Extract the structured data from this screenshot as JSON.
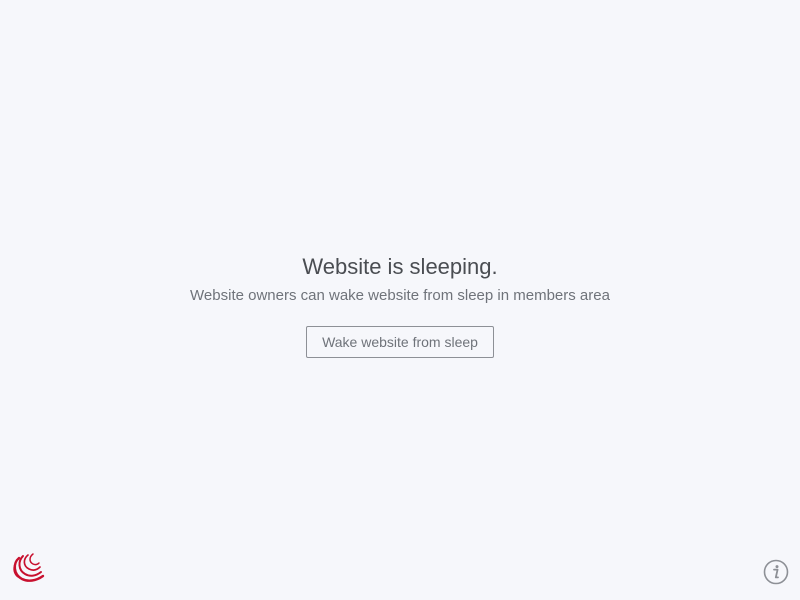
{
  "main": {
    "title": "Website is sleeping.",
    "subtitle": "Website owners can wake website from sleep in members area",
    "wake_button_label": "Wake website from sleep"
  },
  "footer": {
    "logo_icon": "hosting-logo-icon",
    "info_icon": "info-icon"
  },
  "colors": {
    "background": "#f6f7fb",
    "logo_red": "#c8102e",
    "text_dark": "#4a4d52",
    "text_muted": "#6f737a"
  }
}
